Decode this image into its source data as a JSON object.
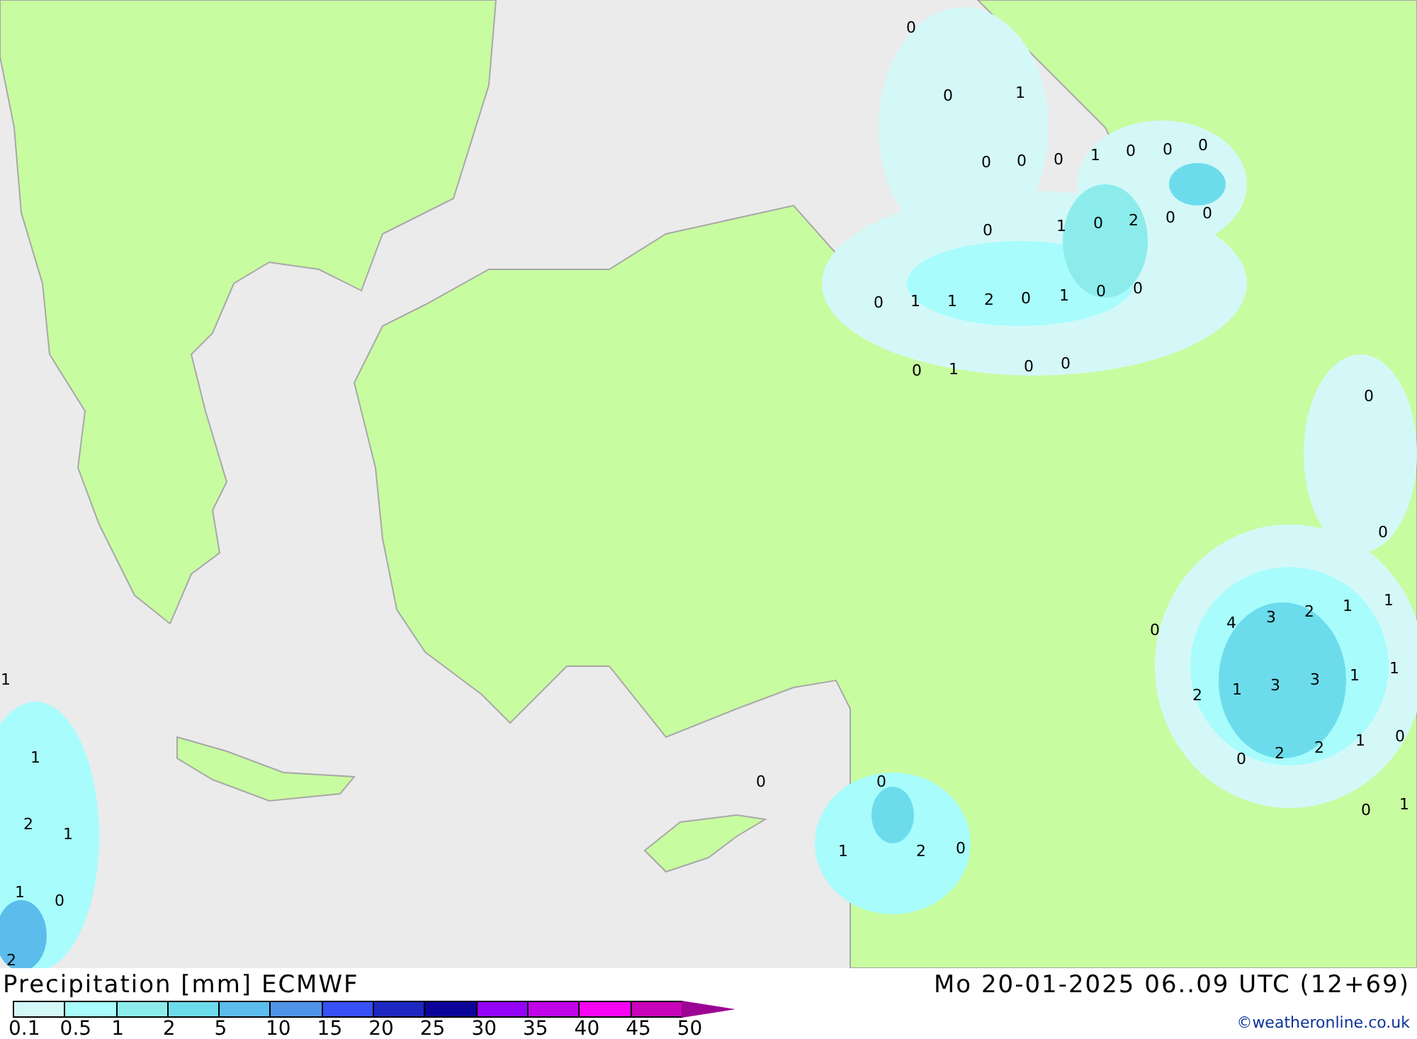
{
  "map": {
    "values": [
      "0",
      "0",
      "1",
      "0",
      "0",
      "0",
      "1",
      "0",
      "0",
      "0",
      "0",
      "1",
      "0",
      "2",
      "0",
      "0",
      "0",
      "1",
      "1",
      "2",
      "0",
      "1",
      "0",
      "0",
      "0",
      "1",
      "0",
      "0",
      "0",
      "0",
      "0",
      "4",
      "3",
      "2",
      "1",
      "1",
      "2",
      "1",
      "3",
      "3",
      "1",
      "1",
      "0",
      "2",
      "2",
      "1",
      "0",
      "0",
      "1",
      "0",
      "0",
      "1",
      "2",
      "0",
      "1",
      "1",
      "2",
      "1",
      "1",
      "0",
      "2"
    ]
  },
  "footer": {
    "title": "Precipitation [mm] ECMWF",
    "valid_time": "Mo 20-01-2025 06..09 UTC (12+69)",
    "credit": "©weatheronline.co.uk"
  },
  "legend": {
    "bins": [
      {
        "color": "#d4f8f8"
      },
      {
        "color": "#a8fcfc"
      },
      {
        "color": "#8cecec"
      },
      {
        "color": "#6cdcec"
      },
      {
        "color": "#5cbcec"
      },
      {
        "color": "#5094e8"
      },
      {
        "color": "#3850f8"
      },
      {
        "color": "#1c28c0"
      },
      {
        "color": "#0c0498"
      },
      {
        "color": "#9404f8"
      },
      {
        "color": "#c004e8"
      },
      {
        "color": "#f804f4"
      },
      {
        "color": "#c804b8"
      },
      {
        "color": "#9c0494",
        "kind": "arrow"
      }
    ],
    "labels": [
      "0.1",
      "0.5",
      "1",
      "2",
      "5",
      "10",
      "15",
      "20",
      "25",
      "30",
      "35",
      "40",
      "45",
      "50"
    ]
  }
}
